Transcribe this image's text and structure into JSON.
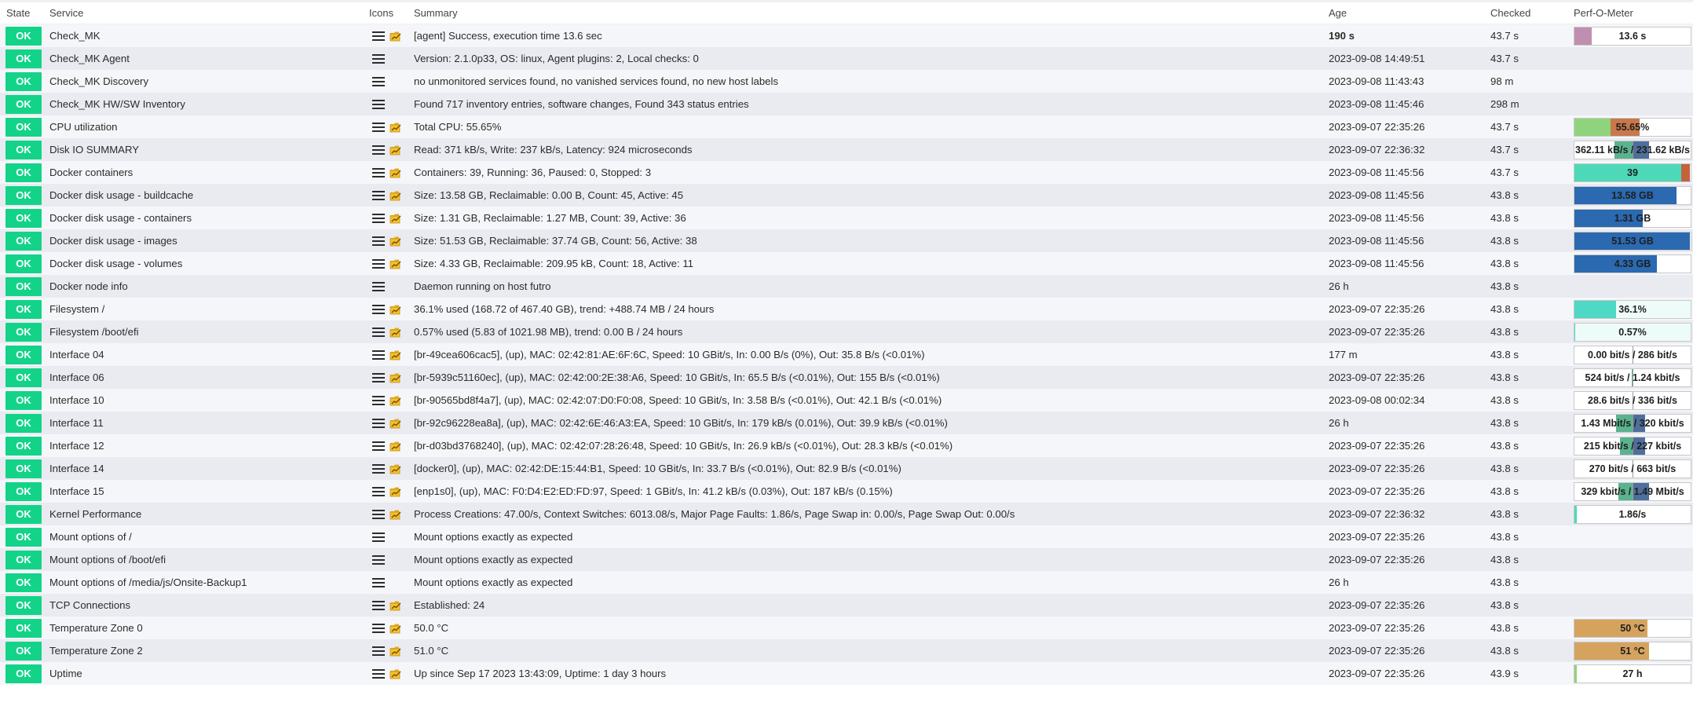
{
  "columns": {
    "state": "State",
    "service": "Service",
    "icons": "Icons",
    "summary": "Summary",
    "age": "Age",
    "checked": "Checked",
    "perf": "Perf-O-Meter"
  },
  "colors": {
    "ok": "#13d389",
    "stripe_odd": "#f5f6f9",
    "stripe_even": "#eaebf1"
  },
  "services": [
    {
      "state": "OK",
      "service": "Check_MK",
      "graph": true,
      "summary": "[agent] Success, execution time 13.6 sec",
      "age": "190 s",
      "age_bold": true,
      "checked": "43.7 s",
      "perf": {
        "type": "bar",
        "label": "13.6 s",
        "fill": 0.15,
        "color": "#c08fb0"
      }
    },
    {
      "state": "OK",
      "service": "Check_MK Agent",
      "graph": false,
      "summary": "Version: 2.1.0p33, OS: linux, Agent plugins: 2, Local checks: 0",
      "age": "2023-09-08 14:49:51",
      "checked": "43.7 s",
      "perf": null
    },
    {
      "state": "OK",
      "service": "Check_MK Discovery",
      "graph": false,
      "summary": "no unmonitored services found, no vanished services found, no new host labels",
      "age": "2023-09-08 11:43:43",
      "checked": "98 m",
      "perf": null
    },
    {
      "state": "OK",
      "service": "Check_MK HW/SW Inventory",
      "graph": false,
      "summary": "Found 717 inventory entries, software changes, Found 343 status entries",
      "age": "2023-09-08 11:45:46",
      "checked": "298 m",
      "perf": null
    },
    {
      "state": "OK",
      "service": "CPU utilization",
      "graph": true,
      "summary": "Total CPU: 55.65%",
      "age": "2023-09-07 22:35:26",
      "checked": "43.7 s",
      "perf": {
        "type": "stack",
        "label": "55.65%",
        "segments": [
          {
            "frac": 0.31,
            "color": "#8fd47c"
          },
          {
            "frac": 0.25,
            "color": "#c8784a"
          }
        ]
      }
    },
    {
      "state": "OK",
      "service": "Disk IO SUMMARY",
      "graph": true,
      "summary": "Read: 371 kB/s, Write: 237 kB/s, Latency: 924 microseconds",
      "age": "2023-09-07 22:36:32",
      "checked": "43.7 s",
      "perf": {
        "type": "dual",
        "label": "362.11 kB/s / 231.62 kB/s",
        "left": 0.31,
        "right": 0.28,
        "left_color": "#5ab38e",
        "right_color": "#4e6f9b"
      }
    },
    {
      "state": "OK",
      "service": "Docker containers",
      "graph": true,
      "summary": "Containers: 39, Running: 36, Paused: 0, Stopped: 3",
      "age": "2023-09-08 11:45:56",
      "checked": "43.7 s",
      "perf": {
        "type": "stack",
        "label": "39",
        "segments": [
          {
            "frac": 0.92,
            "color": "#4dd9b8"
          },
          {
            "frac": 0.07,
            "color": "#c4613f"
          }
        ]
      }
    },
    {
      "state": "OK",
      "service": "Docker disk usage - buildcache",
      "graph": true,
      "summary": "Size: 13.58 GB, Reclaimable: 0.00 B, Count: 45, Active: 45",
      "age": "2023-09-08 11:45:56",
      "checked": "43.8 s",
      "perf": {
        "type": "bar",
        "label": "13.58 GB",
        "fill": 0.88,
        "color": "#2b69b0"
      }
    },
    {
      "state": "OK",
      "service": "Docker disk usage - containers",
      "graph": true,
      "summary": "Size: 1.31 GB, Reclaimable: 1.27 MB, Count: 39, Active: 36",
      "age": "2023-09-08 11:45:56",
      "checked": "43.8 s",
      "perf": {
        "type": "bar",
        "label": "1.31 GB",
        "fill": 0.59,
        "color": "#2b69b0"
      }
    },
    {
      "state": "OK",
      "service": "Docker disk usage - images",
      "graph": true,
      "summary": "Size: 51.53 GB, Reclaimable: 37.74 GB, Count: 56, Active: 38",
      "age": "2023-09-08 11:45:56",
      "checked": "43.8 s",
      "perf": {
        "type": "bar",
        "label": "51.53 GB",
        "fill": 0.99,
        "color": "#2b69b0"
      }
    },
    {
      "state": "OK",
      "service": "Docker disk usage - volumes",
      "graph": true,
      "summary": "Size: 4.33 GB, Reclaimable: 209.95 kB, Count: 18, Active: 11",
      "age": "2023-09-08 11:45:56",
      "checked": "43.8 s",
      "perf": {
        "type": "bar",
        "label": "4.33 GB",
        "fill": 0.71,
        "color": "#2b69b0"
      }
    },
    {
      "state": "OK",
      "service": "Docker node info",
      "graph": false,
      "summary": "Daemon running on host futro",
      "age": "26 h",
      "checked": "43.8 s",
      "perf": null
    },
    {
      "state": "OK",
      "service": "Filesystem /",
      "graph": true,
      "summary": "36.1% used (168.72 of 467.40 GB), trend: +488.74 MB / 24 hours",
      "age": "2023-09-07 22:35:26",
      "checked": "43.8 s",
      "perf": {
        "type": "bar",
        "label": "36.1%",
        "fill": 0.361,
        "color": "#4dd9c4",
        "bg": "#eefcf9"
      }
    },
    {
      "state": "OK",
      "service": "Filesystem /boot/efi",
      "graph": true,
      "summary": "0.57% used (5.83 of 1021.98 MB), trend: 0.00 B / 24 hours",
      "age": "2023-09-07 22:35:26",
      "checked": "43.8 s",
      "perf": {
        "type": "bar",
        "label": "0.57%",
        "fill": 0.01,
        "color": "#4dd9c4",
        "bg": "#eefcf9"
      }
    },
    {
      "state": "OK",
      "service": "Interface 04",
      "graph": true,
      "summary": "[br-49cea606cac5], (up), MAC: 02:42:81:AE:6F:6C, Speed: 10 GBit/s, In: 0.00 B/s (0%), Out: 35.8 B/s (<0.01%)",
      "age": "177 m",
      "checked": "43.8 s",
      "perf": {
        "type": "dual",
        "label": "0.00 bit/s / 286 bit/s",
        "left": 0.0,
        "right": 0.01,
        "left_color": "#5ab38e",
        "right_color": "#4e6f9b"
      }
    },
    {
      "state": "OK",
      "service": "Interface 06",
      "graph": true,
      "summary": "[br-5939c51160ec], (up), MAC: 02:42:00:2E:38:A6, Speed: 10 GBit/s, In: 65.5 B/s (<0.01%), Out: 155 B/s (<0.01%)",
      "age": "2023-09-07 22:35:26",
      "checked": "43.8 s",
      "perf": {
        "type": "dual",
        "label": "524 bit/s / 1.24 kbit/s",
        "left": 0.01,
        "right": 0.02,
        "left_color": "#5ab38e",
        "right_color": "#4e6f9b"
      }
    },
    {
      "state": "OK",
      "service": "Interface 10",
      "graph": true,
      "summary": "[br-90565bd8f4a7], (up), MAC: 02:42:07:D0:F0:08, Speed: 10 GBit/s, In: 3.58 B/s (<0.01%), Out: 42.1 B/s (<0.01%)",
      "age": "2023-09-08 00:02:34",
      "checked": "43.8 s",
      "perf": {
        "type": "dual",
        "label": "28.6 bit/s / 336 bit/s",
        "left": 0.0,
        "right": 0.01,
        "left_color": "#5ab38e",
        "right_color": "#4e6f9b"
      }
    },
    {
      "state": "OK",
      "service": "Interface 11",
      "graph": true,
      "summary": "[br-92c96228ea8a], (up), MAC: 02:42:6E:46:A3:EA, Speed: 10 GBit/s, In: 179 kB/s (0.01%), Out: 39.9 kB/s (<0.01%)",
      "age": "26 h",
      "checked": "43.8 s",
      "perf": {
        "type": "dual",
        "label": "1.43 Mbit/s / 320 kbit/s",
        "left": 0.28,
        "right": 0.22,
        "left_color": "#5ab38e",
        "right_color": "#4e6f9b"
      }
    },
    {
      "state": "OK",
      "service": "Interface 12",
      "graph": true,
      "summary": "[br-d03bd3768240], (up), MAC: 02:42:07:28:26:48, Speed: 10 GBit/s, In: 26.9 kB/s (<0.01%), Out: 28.3 kB/s (<0.01%)",
      "age": "2023-09-07 22:35:26",
      "checked": "43.8 s",
      "perf": {
        "type": "dual",
        "label": "215 kbit/s / 227 kbit/s",
        "left": 0.21,
        "right": 0.22,
        "left_color": "#5ab38e",
        "right_color": "#4e6f9b"
      }
    },
    {
      "state": "OK",
      "service": "Interface 14",
      "graph": true,
      "summary": "[docker0], (up), MAC: 02:42:DE:15:44:B1, Speed: 10 GBit/s, In: 33.7 B/s (<0.01%), Out: 82.9 B/s (<0.01%)",
      "age": "2023-09-07 22:35:26",
      "checked": "43.8 s",
      "perf": {
        "type": "dual",
        "label": "270 bit/s / 663 bit/s",
        "left": 0.0,
        "right": 0.01,
        "left_color": "#5ab38e",
        "right_color": "#4e6f9b"
      }
    },
    {
      "state": "OK",
      "service": "Interface 15",
      "graph": true,
      "summary": "[enp1s0], (up), MAC: F0:D4:E2:ED:FD:97, Speed: 1 GBit/s, In: 41.2 kB/s (0.03%), Out: 187 kB/s (0.15%)",
      "age": "2023-09-07 22:35:26",
      "checked": "43.8 s",
      "perf": {
        "type": "dual",
        "label": "329 kbit/s / 1.49 Mbit/s",
        "left": 0.24,
        "right": 0.28,
        "left_color": "#5ab38e",
        "right_color": "#4e6f9b"
      }
    },
    {
      "state": "OK",
      "service": "Kernel Performance",
      "graph": true,
      "summary": "Process Creations: 47.00/s, Context Switches: 6013.08/s, Major Page Faults: 1.86/s, Page Swap in: 0.00/s, Page Swap Out: 0.00/s",
      "age": "2023-09-07 22:36:32",
      "checked": "43.8 s",
      "perf": {
        "type": "bar",
        "label": "1.86/s",
        "fill": 0.02,
        "color": "#4dd9b8"
      }
    },
    {
      "state": "OK",
      "service": "Mount options of /",
      "graph": false,
      "summary": "Mount options exactly as expected",
      "age": "2023-09-07 22:35:26",
      "checked": "43.8 s",
      "perf": null
    },
    {
      "state": "OK",
      "service": "Mount options of /boot/efi",
      "graph": false,
      "summary": "Mount options exactly as expected",
      "age": "2023-09-07 22:35:26",
      "checked": "43.8 s",
      "perf": null
    },
    {
      "state": "OK",
      "service": "Mount options of /media/js/Onsite-Backup1",
      "graph": false,
      "summary": "Mount options exactly as expected",
      "age": "26 h",
      "checked": "43.8 s",
      "perf": null
    },
    {
      "state": "OK",
      "service": "TCP Connections",
      "graph": true,
      "summary": "Established: 24",
      "age": "2023-09-07 22:35:26",
      "checked": "43.8 s",
      "perf": null
    },
    {
      "state": "OK",
      "service": "Temperature Zone 0",
      "graph": true,
      "summary": "50.0 °C",
      "age": "2023-09-07 22:35:26",
      "checked": "43.8 s",
      "perf": {
        "type": "bar",
        "label": "50 °C",
        "fill": 0.63,
        "color": "#d5a35e"
      }
    },
    {
      "state": "OK",
      "service": "Temperature Zone 2",
      "graph": true,
      "summary": "51.0 °C",
      "age": "2023-09-07 22:35:26",
      "checked": "43.8 s",
      "perf": {
        "type": "bar",
        "label": "51 °C",
        "fill": 0.64,
        "color": "#d5a35e"
      }
    },
    {
      "state": "OK",
      "service": "Uptime",
      "graph": true,
      "summary": "Up since Sep 17 2023 13:43:09, Uptime: 1 day 3 hours",
      "age": "2023-09-07 22:35:26",
      "checked": "43.9 s",
      "perf": {
        "type": "bar",
        "label": "27 h",
        "fill": 0.02,
        "color": "#8fd47c"
      }
    }
  ]
}
